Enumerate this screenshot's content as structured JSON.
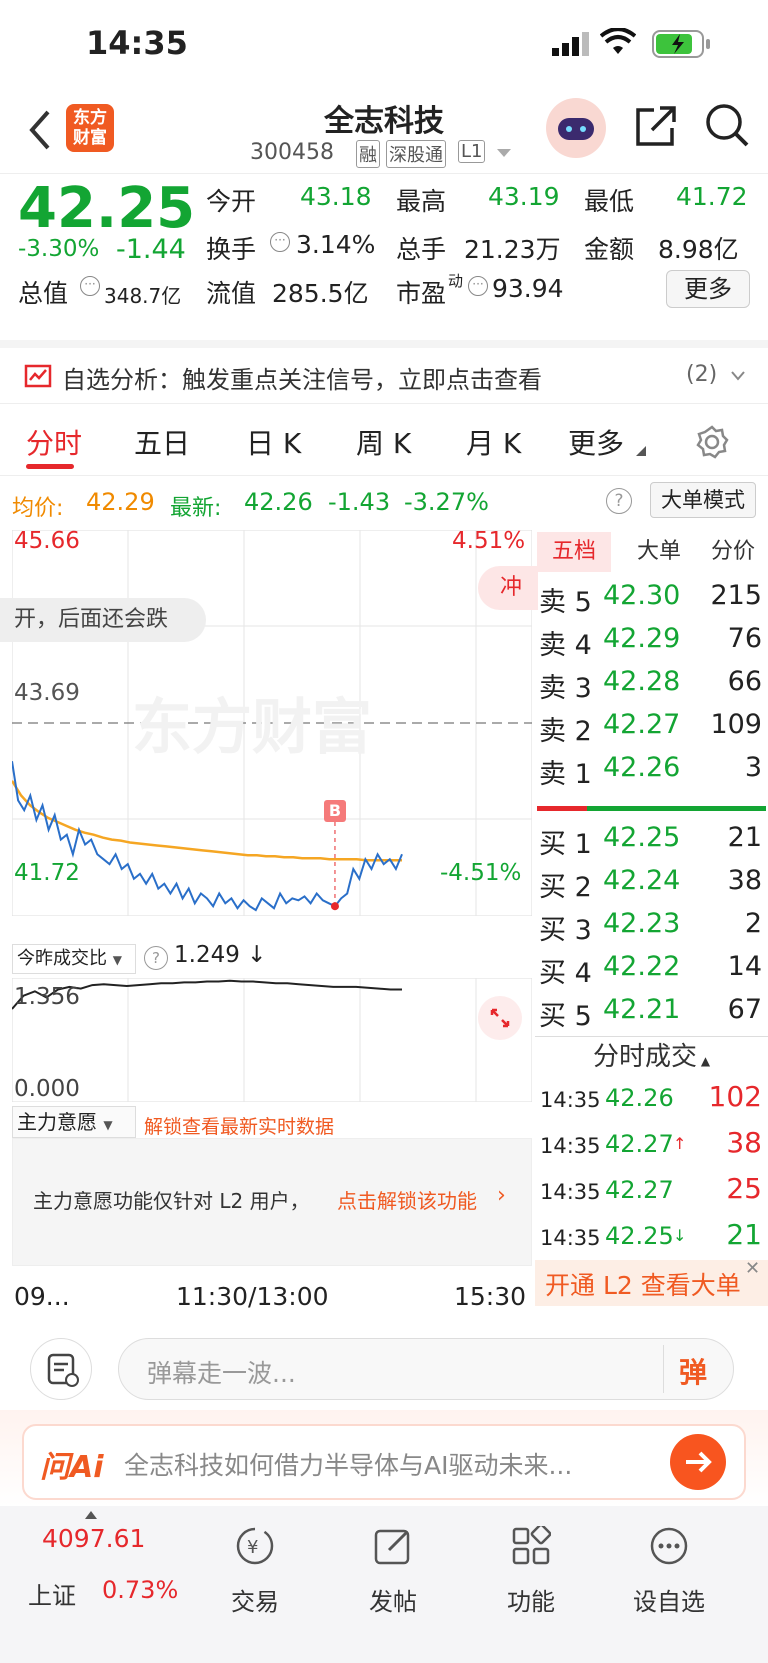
{
  "status": {
    "time": "14:35"
  },
  "nav": {
    "title": "全志科技",
    "code": "300458",
    "tags": [
      "融",
      "深股通",
      "L1"
    ],
    "logo_line1": "东方",
    "logo_line2": "财富"
  },
  "quote": {
    "price": "42.25",
    "pct": "-3.30%",
    "change": "-1.44",
    "open_label": "今开",
    "open": "43.18",
    "high_label": "最高",
    "high": "43.19",
    "low_label": "最低",
    "low": "41.72",
    "turnover_label": "换手",
    "turnover": "3.14%",
    "volume_label": "总手",
    "volume": "21.23万",
    "amount_label": "金额",
    "amount": "8.98亿",
    "mktcap_label": "总值",
    "mktcap": "348.7亿",
    "float_label": "流值",
    "float": "285.5亿",
    "pe_label": "市盈",
    "pe_sup": "动",
    "pe": "93.94",
    "more_button": "更多"
  },
  "alert": {
    "text": "自选分析：触发重点关注信号，立即点击查看",
    "count": "(2)"
  },
  "tabs": [
    {
      "label": "分时",
      "active": true
    },
    {
      "label": "五日"
    },
    {
      "label": "日 K"
    },
    {
      "label": "周 K"
    },
    {
      "label": "月 K"
    },
    {
      "label": "更多"
    }
  ],
  "priceinfo": {
    "avg_label": "均价:",
    "avg": "42.29",
    "latest_label": "最新:",
    "latest": "42.26",
    "chg": "-1.43",
    "pct": "-3.27%",
    "mode_button": "大单模式"
  },
  "chart": {
    "top_price": "45.66",
    "top_pct": "4.51%",
    "mid_price": "43.69",
    "bottom_price": "41.72",
    "bottom_pct": "-4.51%",
    "watermark": "东方财富",
    "comment_overlay": "开，后面还会跌",
    "chong_badge": "冲",
    "marker": "B",
    "price_series": [
      43.3,
      42.9,
      42.8,
      42.95,
      42.7,
      42.85,
      42.6,
      42.75,
      42.5,
      42.55,
      42.35,
      42.6,
      42.45,
      42.5,
      42.35,
      42.3,
      42.25,
      42.35,
      42.2,
      42.25,
      42.1,
      42.15,
      42.05,
      42.15,
      42.0,
      42.05,
      41.95,
      42.05,
      41.9,
      42.0,
      41.85,
      41.95,
      41.9,
      41.82,
      41.95,
      41.85,
      41.9,
      41.8,
      41.88,
      41.82,
      41.78,
      41.9,
      41.85,
      41.8,
      41.95,
      41.85,
      41.9,
      41.88,
      41.92,
      41.85,
      41.95,
      41.88,
      41.85,
      41.82,
      41.9,
      41.95,
      42.2,
      42.1,
      42.3,
      42.2,
      42.35,
      42.25,
      42.3,
      42.2,
      42.35
    ],
    "avg_series": [
      43.1,
      42.95,
      42.85,
      42.78,
      42.72,
      42.68,
      42.64,
      42.6,
      42.57,
      42.55,
      42.52,
      42.5,
      42.49,
      42.47,
      42.46,
      42.45,
      42.44,
      42.43,
      42.42,
      42.41,
      42.4,
      42.39,
      42.38,
      42.37,
      42.36,
      42.35,
      42.34,
      42.34,
      42.33,
      42.33,
      42.32,
      42.32,
      42.31,
      42.31,
      42.31,
      42.3,
      42.3,
      42.3,
      42.3,
      42.29,
      42.29,
      42.29,
      42.29,
      42.29
    ],
    "ratio_label": "今昨成交比",
    "ratio_value": "1.249 ↓",
    "ratio_top": "1.356",
    "ratio_bottom": "0.000",
    "ratio_series": [
      1.05,
      1.2,
      1.25,
      1.18,
      1.27,
      1.3,
      1.28,
      1.32,
      1.33,
      1.32,
      1.31,
      1.32,
      1.33,
      1.34,
      1.34,
      1.35,
      1.35,
      1.36,
      1.36,
      1.37,
      1.36,
      1.36,
      1.35,
      1.34,
      1.34,
      1.33,
      1.32,
      1.31,
      1.3,
      1.3,
      1.3,
      1.29,
      1.28,
      1.27,
      1.27
    ],
    "main_label": "主力意愿",
    "main_unlock": "解锁查看最新实时数据",
    "main_notice": "主力意愿功能仅针对 L2 用户，",
    "main_notice_link": "点击解锁该功能",
    "x_start": "09...",
    "x_mid": "11:30/13:00",
    "x_end": "15:30"
  },
  "orderbook": {
    "tabs": [
      "五档",
      "大单",
      "分价"
    ],
    "asks": [
      {
        "label": "卖 5",
        "price": "42.30",
        "vol": "215"
      },
      {
        "label": "卖 4",
        "price": "42.29",
        "vol": "76"
      },
      {
        "label": "卖 3",
        "price": "42.28",
        "vol": "66"
      },
      {
        "label": "卖 2",
        "price": "42.27",
        "vol": "109"
      },
      {
        "label": "卖 1",
        "price": "42.26",
        "vol": "3"
      }
    ],
    "bids": [
      {
        "label": "买 1",
        "price": "42.25",
        "vol": "21"
      },
      {
        "label": "买 2",
        "price": "42.24",
        "vol": "38"
      },
      {
        "label": "买 3",
        "price": "42.23",
        "vol": "2"
      },
      {
        "label": "买 4",
        "price": "42.22",
        "vol": "14"
      },
      {
        "label": "买 5",
        "price": "42.21",
        "vol": "67"
      }
    ],
    "ticks_title": "分时成交",
    "ticks": [
      {
        "time": "14:35",
        "price": "42.26",
        "arrow": "",
        "vol": "102"
      },
      {
        "time": "14:35",
        "price": "42.27",
        "arrow": "↑",
        "vol": "38"
      },
      {
        "time": "14:35",
        "price": "42.27",
        "arrow": "",
        "vol": "25"
      },
      {
        "time": "14:35",
        "price": "42.25",
        "arrow": "↓",
        "vol": "21"
      }
    ],
    "l2_banner": "开通 L2 查看大单"
  },
  "comment": {
    "placeholder": "弹幕走一波...",
    "send": "弹"
  },
  "ai": {
    "logo": "问Ai",
    "text": "全志科技如何借力半导体与AI驱动未来..."
  },
  "bottomnav": {
    "index_value": "4097.61",
    "index_name": "上证",
    "index_pct": "0.73%",
    "items": [
      {
        "label": "交易"
      },
      {
        "label": "发帖"
      },
      {
        "label": "功能"
      },
      {
        "label": "设自选"
      }
    ]
  }
}
